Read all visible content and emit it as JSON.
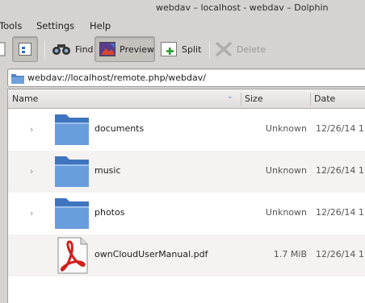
{
  "window": {
    "title": "webdav – localhost - webdav – Dolphin"
  },
  "menu": {
    "tools": "Tools",
    "settings": "Settings",
    "help": "Help"
  },
  "toolbar": {
    "find": "Find",
    "preview": "Preview",
    "split": "Split",
    "delete": "Delete"
  },
  "location": {
    "path": "webdav://localhost/remote.php/webdav/"
  },
  "columns": {
    "name": "Name",
    "size": "Size",
    "date": "Date"
  },
  "files": [
    {
      "name": "documents",
      "size": "Unknown",
      "date": "12/26/14 1",
      "type": "folder"
    },
    {
      "name": "music",
      "size": "Unknown",
      "date": "12/26/14 1",
      "type": "folder"
    },
    {
      "name": "photos",
      "size": "Unknown",
      "date": "12/26/14 1",
      "type": "folder"
    },
    {
      "name": "ownCloudUserManual.pdf",
      "size": "1.7 MiB",
      "date": "12/26/14 1",
      "type": "pdf"
    }
  ],
  "colors": {
    "folder": "#5f93d4",
    "pdf_red": "#d0201a",
    "window_bg": "#d6d2d0"
  }
}
